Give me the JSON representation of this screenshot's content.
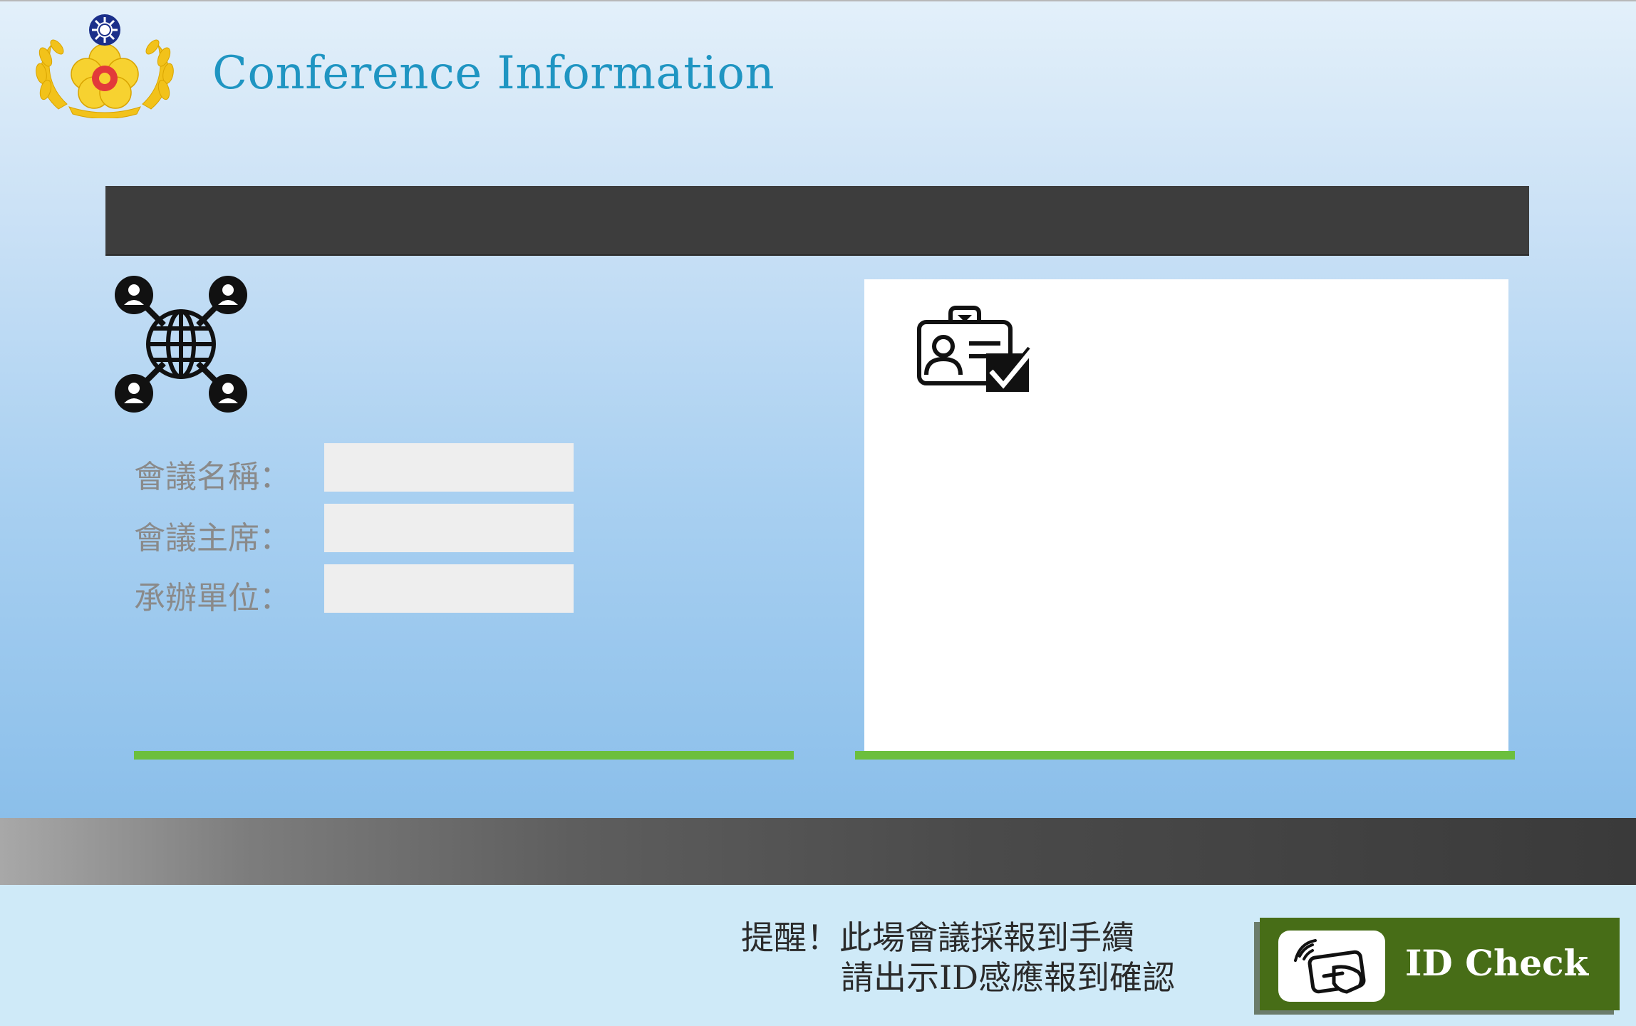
{
  "header": {
    "title": "Conference Information",
    "logo_icon": "national-emblem-icon"
  },
  "banner": {
    "text": ""
  },
  "conference_info": {
    "icon": "global-network-icon",
    "fields": [
      {
        "label": "會議名稱：",
        "value": ""
      },
      {
        "label": "會議主席：",
        "value": ""
      },
      {
        "label": "承辦單位：",
        "value": ""
      }
    ]
  },
  "checkin_panel": {
    "icon": "id-card-check-icon"
  },
  "footer": {
    "reminder_line1": "提醒！此場會議採報到手續",
    "reminder_line2": "請出示ID感應報到確認",
    "id_button": {
      "label": "ID Check",
      "icon": "contactless-card-tap-icon"
    }
  },
  "colors": {
    "title": "#1f95c2",
    "banner": "#3d3d3d",
    "accent_green": "#6cbf3d",
    "button": "#476d17",
    "field_bg": "#eeeeee"
  }
}
